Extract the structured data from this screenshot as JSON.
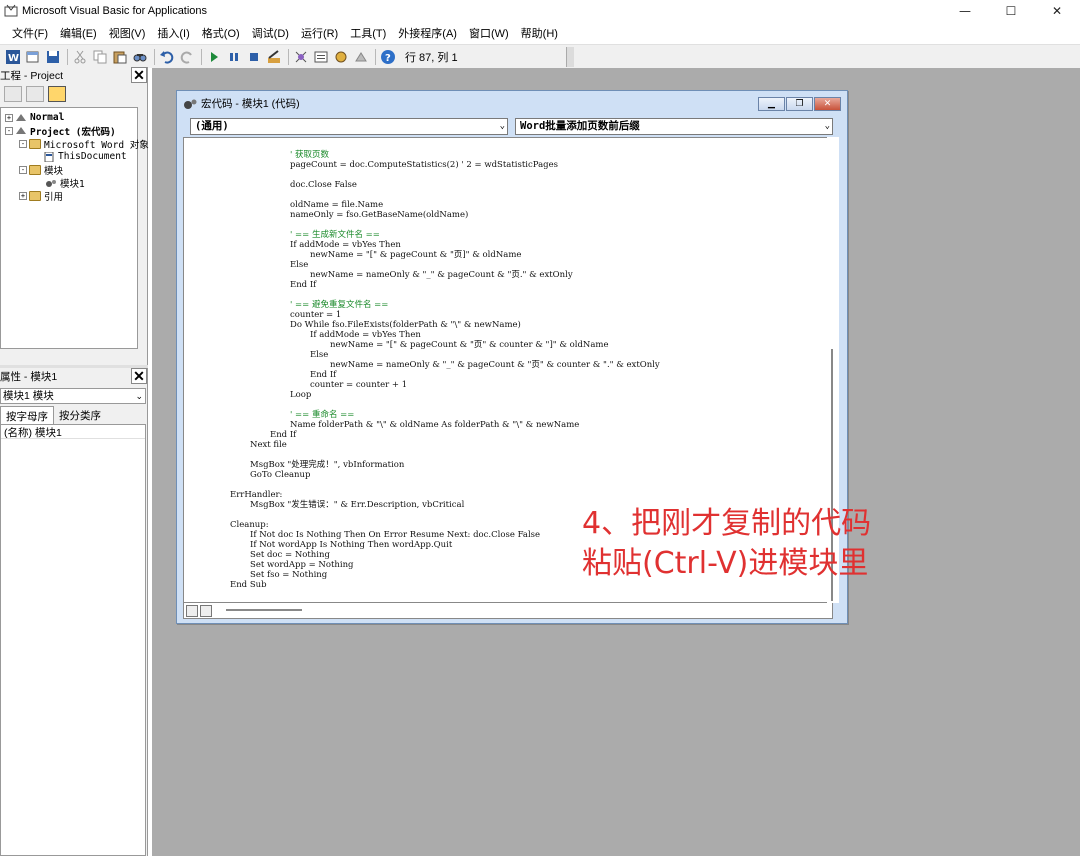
{
  "window": {
    "title": "Microsoft Visual Basic for Applications",
    "controls": [
      "—",
      "☐",
      "✕"
    ]
  },
  "menu": [
    "文件(F)",
    "编辑(E)",
    "视图(V)",
    "插入(I)",
    "格式(O)",
    "调试(D)",
    "运行(R)",
    "工具(T)",
    "外接程序(A)",
    "窗口(W)",
    "帮助(H)"
  ],
  "toolbar": {
    "position": "行 87, 列 1"
  },
  "project_pane": {
    "title": "工程 - Project",
    "close": "✕",
    "tree": [
      {
        "label": "Normal",
        "level": 0,
        "exp": "+",
        "bold": true,
        "icon": "project-icon"
      },
      {
        "label": "Project (宏代码)",
        "level": 0,
        "exp": "-",
        "bold": true,
        "icon": "project-icon"
      },
      {
        "label": "Microsoft Word 对象",
        "level": 1,
        "exp": "-",
        "bold": false,
        "icon": "folder-icon"
      },
      {
        "label": "ThisDocument",
        "level": 2,
        "exp": "",
        "bold": false,
        "icon": "document-icon"
      },
      {
        "label": "模块",
        "level": 1,
        "exp": "-",
        "bold": false,
        "icon": "folder-icon"
      },
      {
        "label": "模块1",
        "level": 2,
        "exp": "",
        "bold": false,
        "icon": "module-icon"
      },
      {
        "label": "引用",
        "level": 1,
        "exp": "+",
        "bold": false,
        "icon": "folder-icon"
      }
    ]
  },
  "properties_pane": {
    "title": "属性 - 模块1",
    "close": "✕",
    "selector": "模块1 模块",
    "tabs": [
      "按字母序",
      "按分类序"
    ],
    "rows": [
      {
        "name": "(名称)",
        "value": "模块1"
      }
    ]
  },
  "code_window": {
    "title": "宏代码 - 模块1 (代码)",
    "object_combo": "(通用)",
    "procedure_combo": "Word批量添加页数前后缀",
    "lines": [
      {
        "indent": 16,
        "text": "' 获取页数",
        "comment": true
      },
      {
        "indent": 16,
        "text": "pageCount = doc.ComputeStatistics(2) ' 2 = wdStatisticPages",
        "comment": false
      },
      {
        "indent": 0,
        "text": "",
        "comment": false
      },
      {
        "indent": 16,
        "text": "doc.Close False",
        "comment": false
      },
      {
        "indent": 0,
        "text": "",
        "comment": false
      },
      {
        "indent": 16,
        "text": "oldName = file.Name",
        "comment": false
      },
      {
        "indent": 16,
        "text": "nameOnly = fso.GetBaseName(oldName)",
        "comment": false
      },
      {
        "indent": 0,
        "text": "",
        "comment": false
      },
      {
        "indent": 16,
        "text": "' == 生成新文件名 ==",
        "comment": true
      },
      {
        "indent": 16,
        "text": "If addMode = vbYes Then",
        "comment": false
      },
      {
        "indent": 20,
        "text": "newName = \"[\" & pageCount & \"页]\" & oldName",
        "comment": false
      },
      {
        "indent": 16,
        "text": "Else",
        "comment": false
      },
      {
        "indent": 20,
        "text": "newName = nameOnly & \"_\" & pageCount & \"页.\" & extOnly",
        "comment": false
      },
      {
        "indent": 16,
        "text": "End If",
        "comment": false
      },
      {
        "indent": 0,
        "text": "",
        "comment": false
      },
      {
        "indent": 16,
        "text": "' == 避免重复文件名 ==",
        "comment": true
      },
      {
        "indent": 16,
        "text": "counter = 1",
        "comment": false
      },
      {
        "indent": 16,
        "text": "Do While fso.FileExists(folderPath & \"\\\" & newName)",
        "comment": false
      },
      {
        "indent": 20,
        "text": "If addMode = vbYes Then",
        "comment": false
      },
      {
        "indent": 24,
        "text": "newName = \"[\" & pageCount & \"页\" & counter & \"]\" & oldName",
        "comment": false
      },
      {
        "indent": 20,
        "text": "Else",
        "comment": false
      },
      {
        "indent": 24,
        "text": "newName = nameOnly & \"_\" & pageCount & \"页\" & counter & \".\" & extOnly",
        "comment": false
      },
      {
        "indent": 20,
        "text": "End If",
        "comment": false
      },
      {
        "indent": 20,
        "text": "counter = counter + 1",
        "comment": false
      },
      {
        "indent": 16,
        "text": "Loop",
        "comment": false
      },
      {
        "indent": 0,
        "text": "",
        "comment": false
      },
      {
        "indent": 16,
        "text": "' == 重命名 ==",
        "comment": true
      },
      {
        "indent": 16,
        "text": "Name folderPath & \"\\\" & oldName As folderPath & \"\\\" & newName",
        "comment": false
      },
      {
        "indent": 12,
        "text": "End If",
        "comment": false
      },
      {
        "indent": 8,
        "text": "Next file",
        "comment": false
      },
      {
        "indent": 0,
        "text": "",
        "comment": false
      },
      {
        "indent": 8,
        "text": "MsgBox \"处理完成！\", vbInformation",
        "comment": false
      },
      {
        "indent": 8,
        "text": "GoTo Cleanup",
        "comment": false
      },
      {
        "indent": 0,
        "text": "",
        "comment": false
      },
      {
        "indent": 4,
        "text": "ErrHandler:",
        "comment": false
      },
      {
        "indent": 8,
        "text": "MsgBox \"发生错误：\" & Err.Description, vbCritical",
        "comment": false
      },
      {
        "indent": 0,
        "text": "",
        "comment": false
      },
      {
        "indent": 4,
        "text": "Cleanup:",
        "comment": false
      },
      {
        "indent": 8,
        "text": "If Not doc Is Nothing Then On Error Resume Next: doc.Close False",
        "comment": false
      },
      {
        "indent": 8,
        "text": "If Not wordApp Is Nothing Then wordApp.Quit",
        "comment": false
      },
      {
        "indent": 8,
        "text": "Set doc = Nothing",
        "comment": false
      },
      {
        "indent": 8,
        "text": "Set wordApp = Nothing",
        "comment": false
      },
      {
        "indent": 8,
        "text": "Set fso = Nothing",
        "comment": false
      },
      {
        "indent": 4,
        "text": "End Sub",
        "comment": false
      }
    ]
  },
  "annotation": {
    "line1": "4、把刚才复制的代码",
    "line2": "粘贴(Ctrl-V)进模块里",
    "color": "#e03131"
  }
}
